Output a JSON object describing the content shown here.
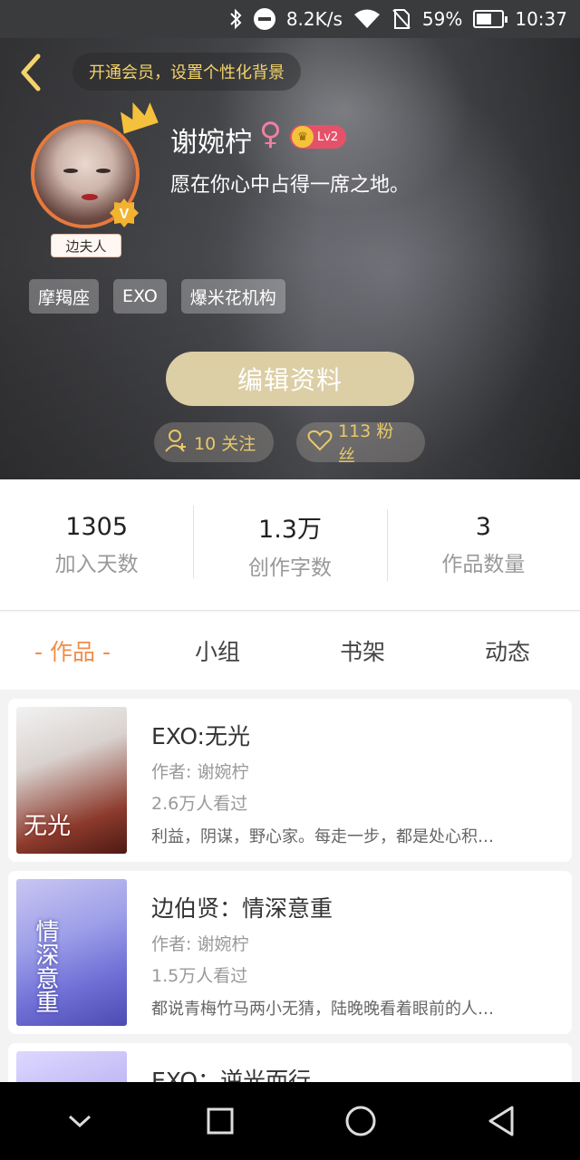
{
  "status_bar": {
    "net_speed": "8.2K/s",
    "battery_pct": "59%",
    "battery_level": 0.59,
    "time": "10:37",
    "icons": [
      "bluetooth-icon",
      "dnd-icon",
      "wifi-icon",
      "no-sim-icon",
      "battery-icon"
    ]
  },
  "header": {
    "vip_promo": "开通会员，设置个性化背景",
    "badge_v": "V",
    "nameplate": "边夫人",
    "username": "谢婉柠",
    "gender_symbol": "♀",
    "level": "Lv2",
    "motto": "愿在你心中占得一席之地。",
    "tags": [
      "摩羯座",
      "EXO",
      "爆米花机构"
    ],
    "edit_button": "编辑资料",
    "follow_label": "10 关注",
    "fans_label": "113 粉丝"
  },
  "stats": [
    {
      "value": "1305",
      "label": "加入天数"
    },
    {
      "value": "1.3万",
      "label": "创作字数"
    },
    {
      "value": "3",
      "label": "作品数量"
    }
  ],
  "tabs": [
    {
      "label": "- 作品 -",
      "active": true
    },
    {
      "label": "小组",
      "active": false
    },
    {
      "label": "书架",
      "active": false
    },
    {
      "label": "动态",
      "active": false
    }
  ],
  "works": [
    {
      "title": "EXO:无光",
      "author": "作者: 谢婉柠",
      "views": "2.6万人看过",
      "desc": "利益，阴谋，野心家。每走一步，都是处心积…",
      "cover_text": "无光"
    },
    {
      "title": "边伯贤：情深意重",
      "author": "作者: 谢婉柠",
      "views": "1.5万人看过",
      "desc": "都说青梅竹马两小无猜，陆晚晚看着眼前的人…",
      "cover_text": "情深意重"
    },
    {
      "title": "EXO：逆光而行",
      "author": "",
      "views": "",
      "desc": "",
      "cover_text": ""
    }
  ],
  "colors": {
    "accent_orange": "#f08d4a",
    "gold": "#e8c869",
    "edit_button_bg": "#dccea5",
    "avatar_ring": "#e77a3b"
  },
  "nav_icons": [
    "chevron-down-icon",
    "recent-apps-icon",
    "home-icon",
    "back-triangle-icon"
  ]
}
